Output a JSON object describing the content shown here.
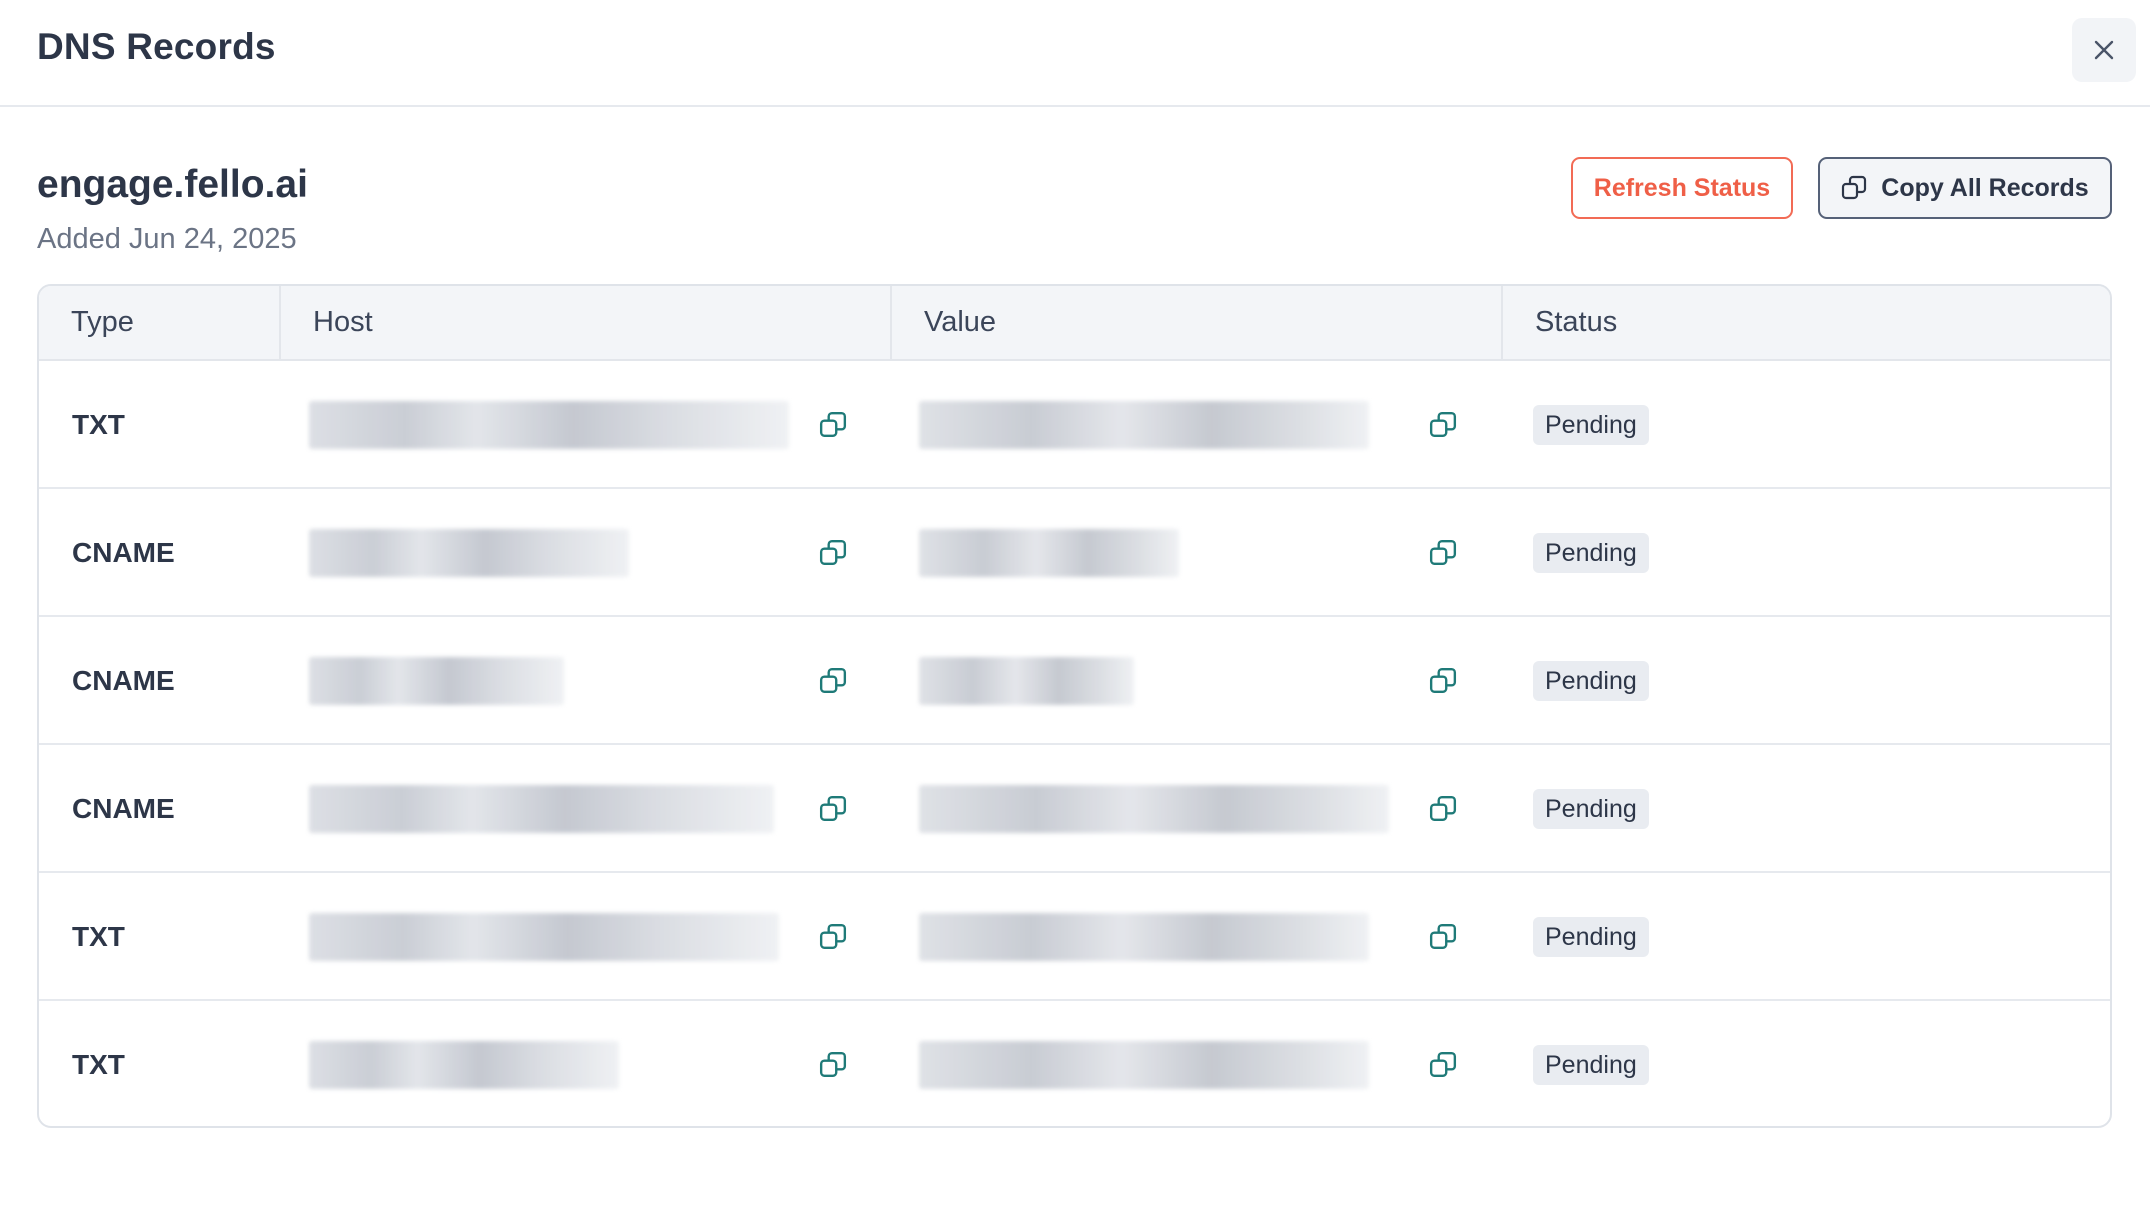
{
  "modal": {
    "title": "DNS Records",
    "close_icon": "close-icon"
  },
  "domain": {
    "name": "engage.fello.ai",
    "added": "Added Jun 24, 2025"
  },
  "actions": {
    "refresh_label": "Refresh Status",
    "copy_all_label": "Copy All Records",
    "copy_icon": "copy-icon"
  },
  "table": {
    "headers": [
      "Type",
      "Host",
      "Value",
      "Status"
    ],
    "rows": [
      {
        "type": "TXT",
        "host": "",
        "value": "",
        "status": "Pending"
      },
      {
        "type": "CNAME",
        "host": "",
        "value": "",
        "status": "Pending"
      },
      {
        "type": "CNAME",
        "host": "",
        "value": "",
        "status": "Pending"
      },
      {
        "type": "CNAME",
        "host": "",
        "value": "",
        "status": "Pending"
      },
      {
        "type": "TXT",
        "host": "",
        "value": "",
        "status": "Pending"
      },
      {
        "type": "TXT",
        "host": "",
        "value": "",
        "status": "Pending"
      }
    ]
  },
  "colors": {
    "accent": "#ef5f47",
    "icon": "#1f7a78",
    "text": "#2d3648",
    "muted": "#6b7485"
  }
}
